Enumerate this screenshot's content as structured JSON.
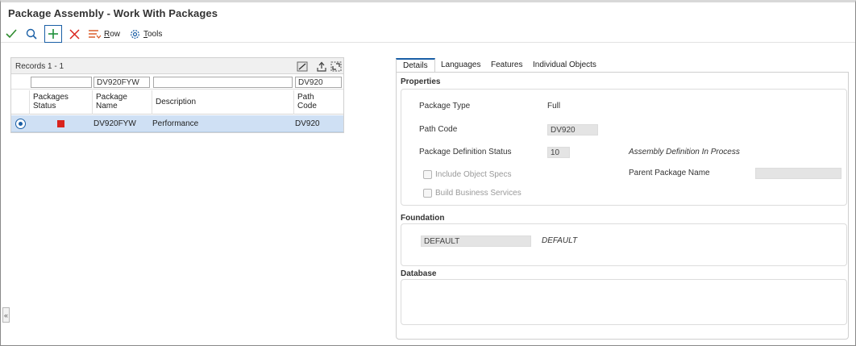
{
  "window": {
    "title": "Package Assembly - Work With Packages"
  },
  "toolbar": {
    "ok_icon": "checkmark-icon",
    "find_icon": "search-icon",
    "add_icon": "plus-icon",
    "delete_icon": "close-icon",
    "row_label": "Row",
    "row_letter": "R",
    "row_rest": "ow",
    "tools_label": "Tools",
    "tools_letter": "T",
    "tools_rest": "ools"
  },
  "grid": {
    "records_label": "Records 1 - 1",
    "header_icons": [
      "edit-grid-icon",
      "export-icon",
      "expand-icon"
    ],
    "qbe": {
      "package_name": "DV920FYW",
      "description": "",
      "path_code": "DV920",
      "status": ""
    },
    "columns": [
      {
        "line1": "Packages",
        "line2": "Status"
      },
      {
        "line1": "Package",
        "line2": "Name"
      },
      {
        "line1": "Description",
        "line2": ""
      },
      {
        "line1": "Path",
        "line2": "Code"
      }
    ],
    "rows": [
      {
        "status_color": "#d9231d",
        "package_name": "DV920FYW",
        "description": "Performance",
        "path_code": "DV920"
      }
    ]
  },
  "tabs": [
    "Details",
    "Languages",
    "Features",
    "Individual Objects"
  ],
  "details": {
    "properties_title": "Properties",
    "package_type_label": "Package Type",
    "package_type_value": "Full",
    "path_code_label": "Path Code",
    "path_code_value": "DV920",
    "pkg_def_status_label": "Package Definition Status",
    "pkg_def_status_value": "10",
    "pkg_def_status_desc": "Assembly Definition In Process",
    "parent_package_label": "Parent Package Name",
    "parent_package_value": "",
    "include_object_specs_label": "Include Object Specs",
    "build_business_services_label": "Build Business Services",
    "foundation_title": "Foundation",
    "foundation_value": "DEFAULT",
    "foundation_desc": "DEFAULT",
    "database_title": "Database"
  }
}
